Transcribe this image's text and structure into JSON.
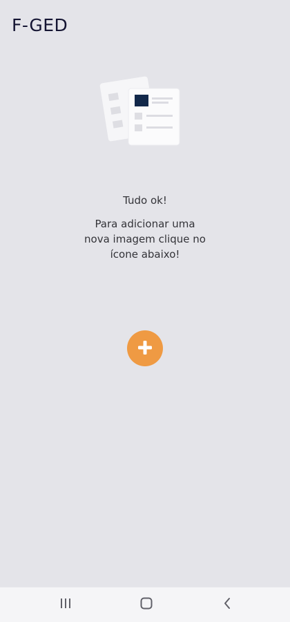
{
  "app": {
    "title": "F-GED"
  },
  "empty_state": {
    "illustration_icon": "documents-illustration-icon",
    "headline": "Tudo ok!",
    "body": "Para adicionar uma nova imagem clique no ícone abaixo!"
  },
  "actions": {
    "add_icon": "plus-icon",
    "add_button_color": "#ef9a43"
  },
  "system_nav": {
    "recents_icon": "recents-icon",
    "home_icon": "home-icon",
    "back_icon": "back-icon"
  },
  "colors": {
    "background": "#e4e4e9",
    "title": "#141432",
    "accent": "#ef9a43"
  }
}
